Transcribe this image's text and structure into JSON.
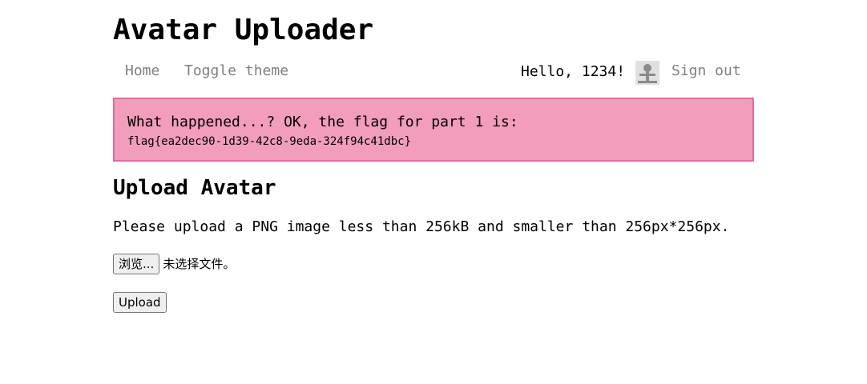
{
  "site": {
    "title": "Avatar Uploader"
  },
  "nav": {
    "home": "Home",
    "toggle_theme": "Toggle theme",
    "greeting": "Hello, 1234!",
    "avatar_icon": "user-avatar",
    "sign_out": "Sign out"
  },
  "alert": {
    "message": "What happened...? OK, the flag for part 1 is:",
    "flag": "flag{ea2dec90-1d39-42c8-9eda-324f94c41dbc}",
    "background": "#f29dbd",
    "border": "#e7699a"
  },
  "upload": {
    "heading": "Upload Avatar",
    "instructions": "Please upload a PNG image less than 256kB and smaller than 256px*256px.",
    "browse_label": "浏览...",
    "file_status": "未选择文件。",
    "submit_label": "Upload"
  }
}
